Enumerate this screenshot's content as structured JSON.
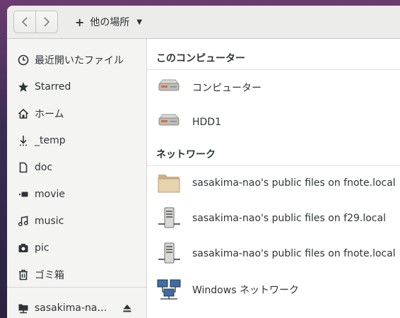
{
  "header": {
    "back_icon": "chevron-left-icon",
    "forward_icon": "chevron-right-icon",
    "location_label": "他の場所"
  },
  "sidebar": {
    "items": [
      {
        "label": "最近開いたファイル",
        "icon": "clock-icon"
      },
      {
        "label": "Starred",
        "icon": "star-icon"
      },
      {
        "label": "ホーム",
        "icon": "home-icon"
      },
      {
        "label": "_temp",
        "icon": "download-icon"
      },
      {
        "label": "doc",
        "icon": "document-icon"
      },
      {
        "label": "movie",
        "icon": "video-icon"
      },
      {
        "label": "music",
        "icon": "music-icon"
      },
      {
        "label": "pic",
        "icon": "camera-icon"
      },
      {
        "label": "ゴミ箱",
        "icon": "trash-icon"
      }
    ],
    "mounted": {
      "label": "sasakima-na…",
      "icon": "network-drive-icon",
      "eject_icon": "eject-icon"
    }
  },
  "main": {
    "computer_section": "このコンピューター",
    "computer_items": [
      {
        "label": "コンピューター",
        "icon": "harddisk-icon"
      },
      {
        "label": "HDD1",
        "icon": "harddisk-icon"
      }
    ],
    "network_section": "ネットワーク",
    "network_items": [
      {
        "label": "sasakima-nao's public files on fnote.local",
        "icon": "folder-icon"
      },
      {
        "label": "sasakima-nao's public files on f29.local",
        "icon": "server-icon"
      },
      {
        "label": "sasakima-nao's public files on fnote.local",
        "icon": "server-icon"
      },
      {
        "label": "Windows ネットワーク",
        "icon": "network-computers-icon"
      }
    ]
  },
  "colors": {
    "sidebar_bg": "#f4f4f3",
    "header_bg": "#ececea",
    "text": "#2e3436"
  }
}
